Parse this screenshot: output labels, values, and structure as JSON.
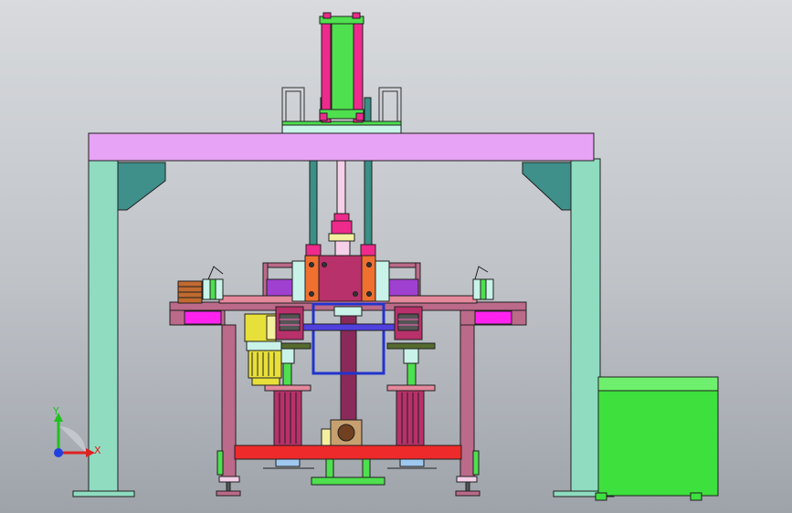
{
  "axis_triad": {
    "x_label": "X",
    "y_label": "Y",
    "x_color": "#e02020",
    "y_color": "#20c020",
    "origin_color": "#2040e0"
  },
  "colors": {
    "frame_column": "#8fdcc0",
    "top_beam": "#e7a3f5",
    "cylinder": "#4ee04e",
    "cylinder_rods": "#ee2a8c",
    "guide_rods": "#3a8f86",
    "table": "#bb6a8a",
    "head_block": "#b8316a",
    "side_plate": "#f07030",
    "base_bar": "#ee2a2a",
    "center_column": "#8a2a5a",
    "blue_frame": "#2233cc",
    "motor": "#e8e03a",
    "cabinet": "#3ee03e",
    "magenta_panel": "#ff22ee"
  }
}
